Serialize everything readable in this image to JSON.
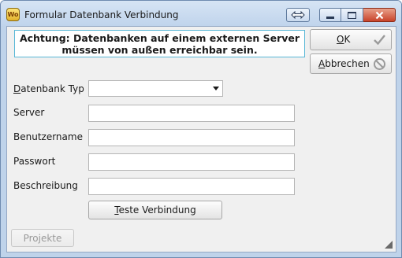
{
  "window": {
    "title": "Formular Datenbank Verbindung",
    "app_icon_text": "Wo"
  },
  "notice": {
    "line1": "Achtung: Datenbanken auf einem externen Server",
    "line2": "müssen von außen erreichbar sein."
  },
  "buttons": {
    "ok_mnemonic": "O",
    "ok_rest": "K",
    "cancel_mnemonic": "A",
    "cancel_rest": "bbrechen",
    "test_mnemonic": "T",
    "test_rest": "este Verbindung",
    "projekte": "Projekte"
  },
  "form": {
    "db_type_mnemonic": "D",
    "db_type_rest": "atenbank Typ",
    "db_type_value": "",
    "server_label": "Server",
    "server_value": "",
    "user_label": "Benutzername",
    "user_value": "",
    "password_label": "Passwort",
    "password_value": "",
    "description_label": "Beschreibung",
    "description_value": ""
  },
  "colors": {
    "notice_border": "#58b7d6",
    "title_bar": "#c0d4ec",
    "close_button": "#c8432a",
    "ok_check": "#9a9a9a",
    "cancel_icon": "#9a9a9a"
  },
  "icons": {
    "app": "app-logo-icon",
    "resize": "double-arrow-icon",
    "minimize": "minimize-icon",
    "maximize": "maximize-icon",
    "close": "close-icon",
    "ok": "checkmark-icon",
    "cancel": "no-entry-icon",
    "dropdown": "chevron-down-icon",
    "grip": "resize-grip-icon"
  }
}
